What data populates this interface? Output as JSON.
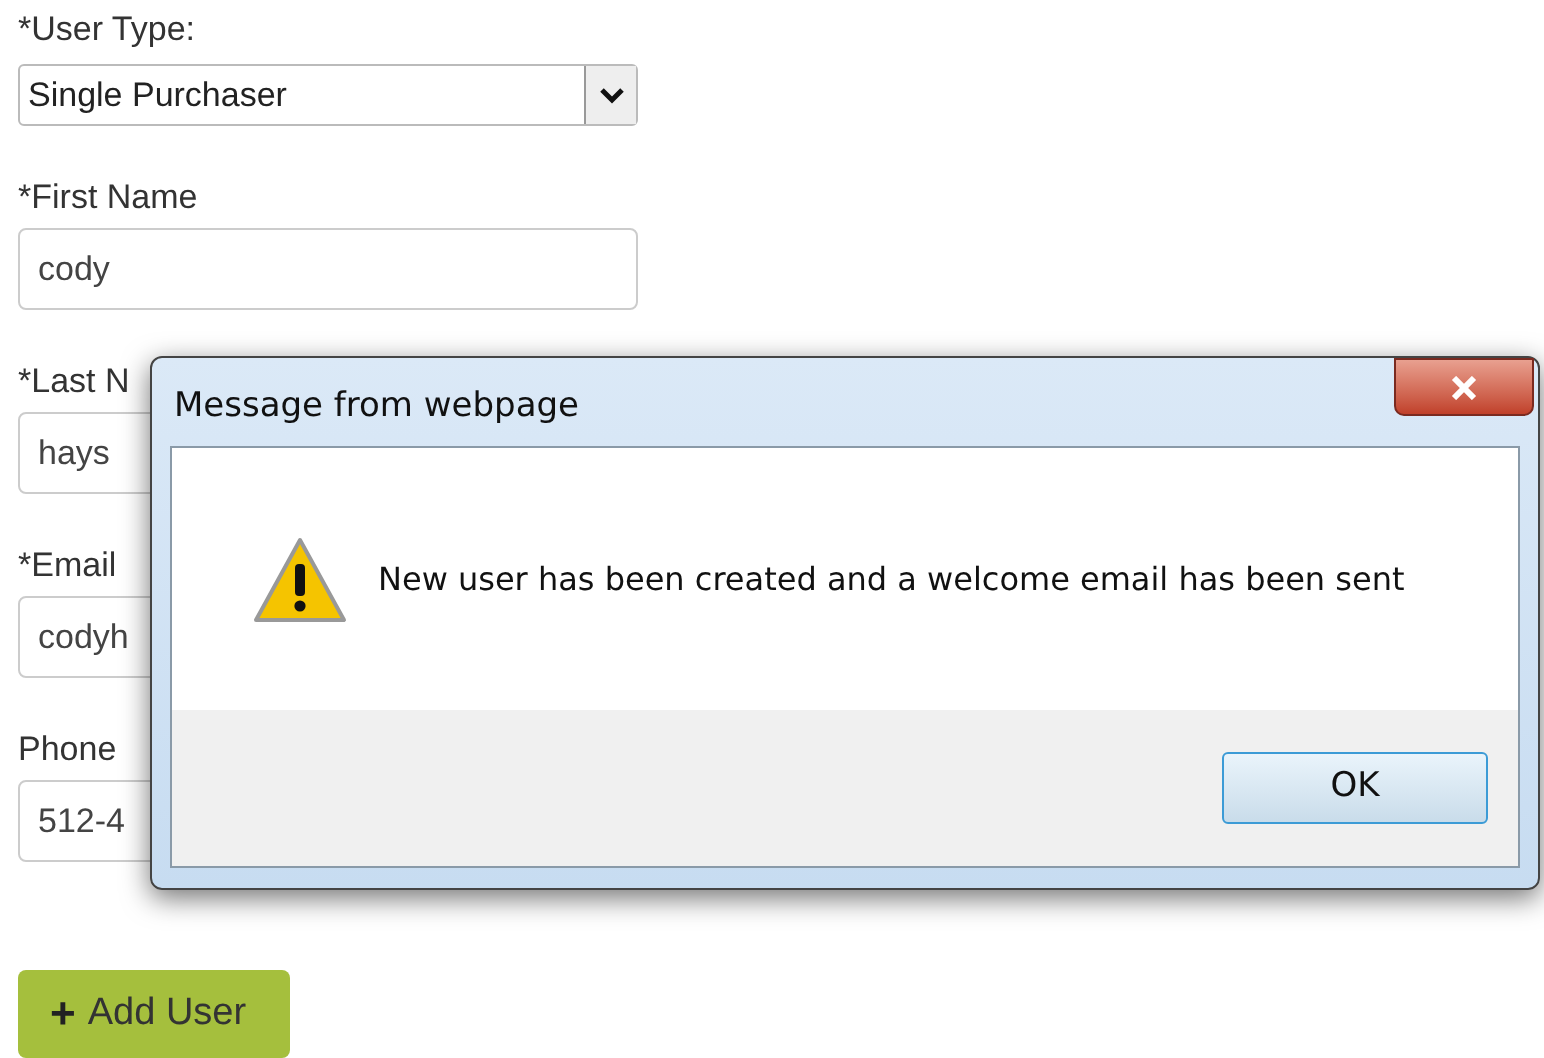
{
  "form": {
    "user_type": {
      "label": "*User Type:",
      "value": "Single Purchaser"
    },
    "fields": [
      {
        "label": "*First Name",
        "value": "cody"
      },
      {
        "label": "*Last N",
        "value": "hays"
      },
      {
        "label": "*Email",
        "value": "codyh"
      },
      {
        "label": "Phone",
        "value": "512-4"
      }
    ],
    "submit": {
      "icon": "+",
      "label": "Add User"
    }
  },
  "dialog": {
    "title": "Message from webpage",
    "message": "New user has been created and a welcome email has been sent",
    "buttons": [
      "OK"
    ]
  }
}
